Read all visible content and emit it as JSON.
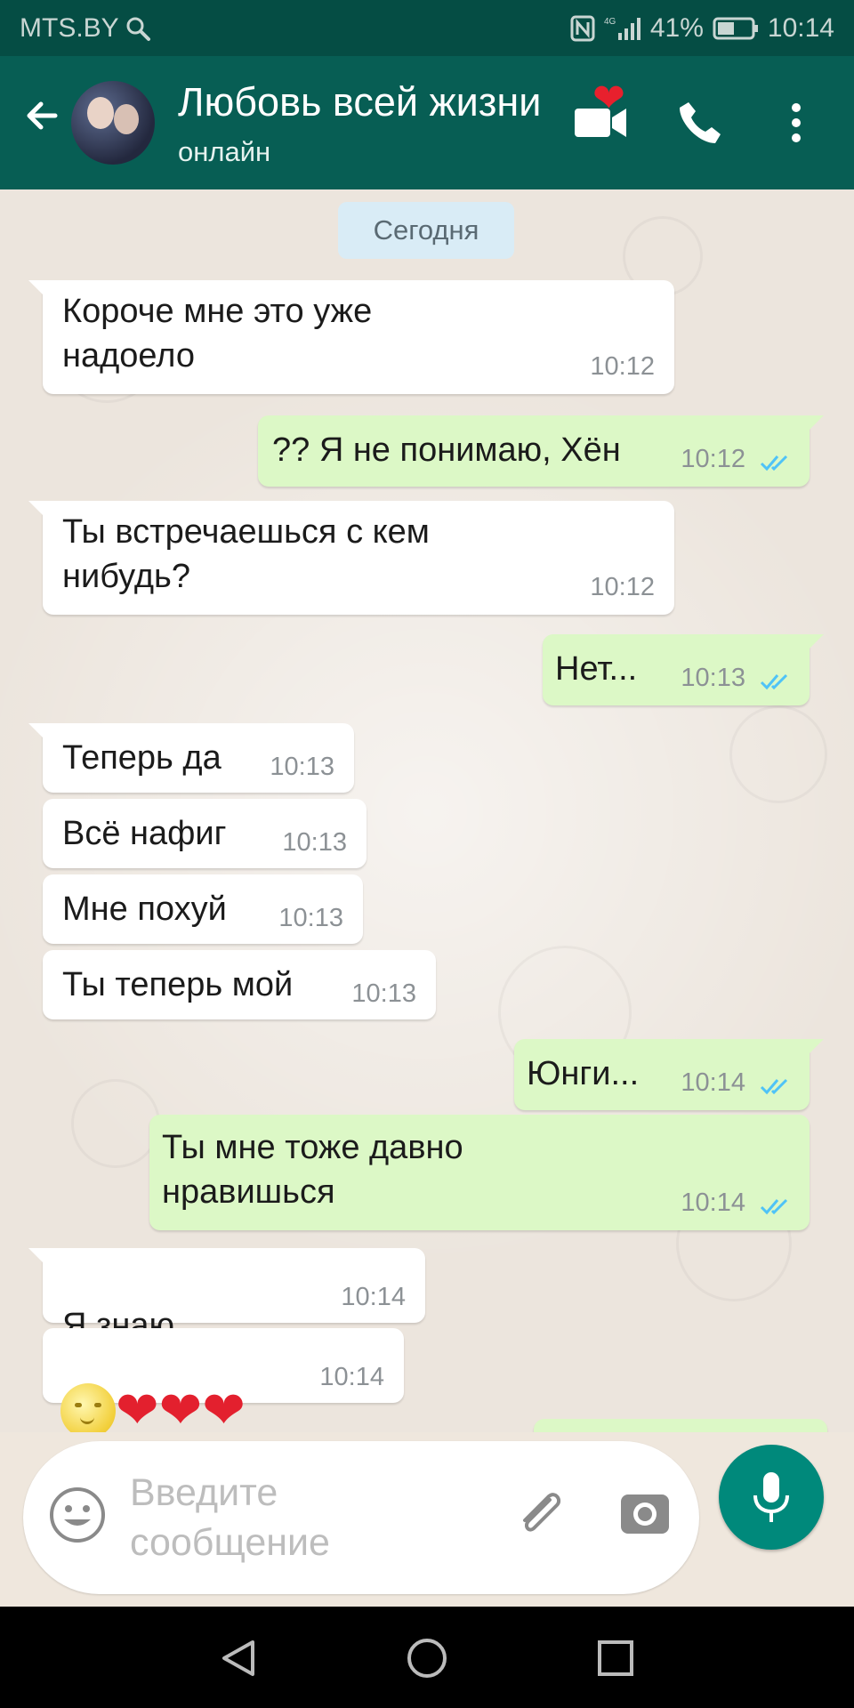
{
  "status_bar": {
    "carrier": "MTS.BY",
    "network": "4G",
    "battery": "41%",
    "time": "10:14"
  },
  "header": {
    "contact_name": "Любовь всей жизни",
    "status": "онлайн",
    "heart": "❤"
  },
  "chat": {
    "date_label": "Сегодня",
    "messages": [
      {
        "dir": "in",
        "text": "Короче мне это уже\nнадоело",
        "time": "10:12"
      },
      {
        "dir": "out",
        "text": "?? Я не понимаю, Хён",
        "time": "10:12"
      },
      {
        "dir": "in",
        "text": "Ты встречаешься с кем\nнибудь?",
        "time": "10:12"
      },
      {
        "dir": "out",
        "text": "Нет...",
        "time": "10:13"
      },
      {
        "dir": "in",
        "text": "Теперь да",
        "time": "10:13"
      },
      {
        "dir": "in",
        "text": "Всё нафиг",
        "time": "10:13"
      },
      {
        "dir": "in",
        "text": "Мне похуй",
        "time": "10:13"
      },
      {
        "dir": "in",
        "text": "Ты теперь мой",
        "time": "10:13"
      },
      {
        "dir": "out",
        "text": "Юнги...",
        "time": "10:14"
      },
      {
        "dir": "out",
        "text": "Ты мне тоже давно\nнравишься",
        "time": "10:14"
      },
      {
        "dir": "in",
        "text": "Я знаю",
        "emoji": [
          "moon-face",
          "red-heart"
        ],
        "time": "10:14"
      },
      {
        "dir": "in",
        "text": "",
        "emoji": [
          "moon-face",
          "red-heart",
          "red-heart",
          "red-heart"
        ],
        "time": "10:14"
      }
    ]
  },
  "input": {
    "placeholder": "Введите\nсообщение"
  },
  "colors": {
    "header": "#075e54",
    "status_bar": "#054d44",
    "outgoing_bubble": "#dcf8c6",
    "incoming_bubble": "#ffffff",
    "read_ticks": "#4fc3f7",
    "mic_button": "#00897b"
  },
  "icons": {
    "status_bar": [
      "search-icon",
      "nfc-icon",
      "signal-icon",
      "battery-icon"
    ],
    "header": [
      "back-arrow-icon",
      "video-call-icon",
      "phone-icon",
      "more-vert-icon"
    ],
    "input": [
      "emoji-icon",
      "attach-icon",
      "camera-icon",
      "mic-icon"
    ],
    "navigation": [
      "back-triangle-icon",
      "home-circle-icon",
      "recents-square-icon"
    ]
  }
}
